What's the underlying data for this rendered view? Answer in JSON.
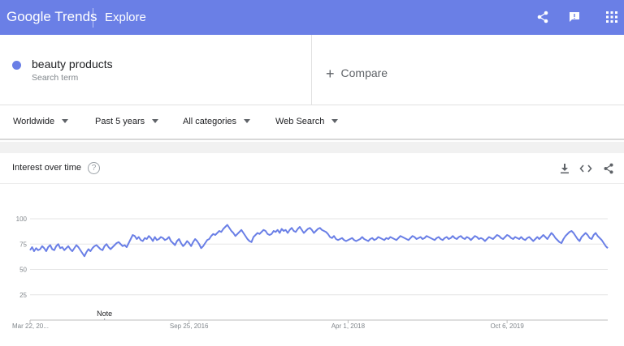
{
  "header": {
    "logo_google": "Google",
    "logo_trends": "Trends",
    "section": "Explore",
    "icons": [
      "share-icon",
      "feedback-icon",
      "apps-icon"
    ]
  },
  "search_term": {
    "name": "beauty products",
    "type": "Search term",
    "color": "#6a7fe6"
  },
  "compare": {
    "label": "Compare"
  },
  "filters": {
    "region": "Worldwide",
    "period": "Past 5 years",
    "category": "All categories",
    "property": "Web Search"
  },
  "card": {
    "title": "Interest over time",
    "help": "?",
    "icons": [
      "download-icon",
      "embed-icon",
      "share-icon"
    ]
  },
  "chart_data": {
    "type": "line",
    "ylim": [
      0,
      100
    ],
    "yticks": [
      25,
      50,
      75,
      100
    ],
    "grid": true,
    "x_tick_labels": [
      {
        "label": "Mar 22, 20...",
        "index": 0
      },
      {
        "label": "Sep 25, 2016",
        "index": 79
      },
      {
        "label": "Apr 1, 2018",
        "index": 158
      },
      {
        "label": "Oct 6, 2019",
        "index": 237
      }
    ],
    "annotation": {
      "label": "Note",
      "index": 37
    },
    "series": [
      {
        "color": "#6a7fe6",
        "values": [
          69,
          72,
          68,
          71,
          69,
          70,
          73,
          71,
          68,
          72,
          74,
          70,
          69,
          73,
          75,
          71,
          72,
          69,
          71,
          73,
          70,
          68,
          71,
          74,
          72,
          69,
          66,
          63,
          67,
          70,
          68,
          71,
          73,
          74,
          72,
          70,
          69,
          73,
          75,
          72,
          70,
          72,
          74,
          76,
          77,
          75,
          73,
          74,
          72,
          76,
          80,
          84,
          83,
          80,
          82,
          79,
          78,
          81,
          80,
          83,
          81,
          78,
          82,
          79,
          80,
          82,
          81,
          79,
          80,
          82,
          78,
          76,
          74,
          78,
          80,
          76,
          73,
          75,
          78,
          76,
          73,
          77,
          80,
          78,
          75,
          71,
          73,
          76,
          79,
          80,
          83,
          85,
          84,
          86,
          88,
          87,
          90,
          92,
          94,
          91,
          88,
          86,
          83,
          85,
          87,
          89,
          86,
          83,
          80,
          78,
          77,
          82,
          84,
          86,
          85,
          87,
          89,
          88,
          85,
          84,
          85,
          88,
          87,
          89,
          86,
          90,
          88,
          89,
          86,
          89,
          91,
          88,
          87,
          90,
          92,
          89,
          86,
          88,
          90,
          91,
          89,
          86,
          88,
          90,
          91,
          89,
          88,
          87,
          85,
          82,
          81,
          83,
          80,
          79,
          80,
          81,
          79,
          78,
          79,
          80,
          81,
          79,
          78,
          79,
          80,
          82,
          80,
          79,
          78,
          80,
          81,
          79,
          80,
          82,
          81,
          80,
          79,
          81,
          80,
          82,
          81,
          80,
          79,
          81,
          83,
          82,
          81,
          80,
          79,
          81,
          83,
          82,
          80,
          81,
          82,
          80,
          81,
          83,
          82,
          81,
          80,
          79,
          81,
          82,
          80,
          79,
          81,
          82,
          80,
          81,
          83,
          81,
          80,
          82,
          83,
          81,
          80,
          82,
          81,
          79,
          81,
          83,
          82,
          80,
          81,
          80,
          78,
          80,
          82,
          81,
          80,
          82,
          84,
          83,
          81,
          80,
          82,
          84,
          83,
          81,
          80,
          82,
          81,
          80,
          82,
          80,
          79,
          81,
          82,
          80,
          78,
          80,
          82,
          80,
          82,
          84,
          82,
          80,
          83,
          86,
          84,
          81,
          79,
          77,
          76,
          80,
          83,
          85,
          87,
          88,
          86,
          83,
          80,
          78,
          82,
          84,
          86,
          84,
          81,
          80,
          84,
          86,
          83,
          81,
          79,
          76,
          73,
          71
        ]
      }
    ]
  }
}
